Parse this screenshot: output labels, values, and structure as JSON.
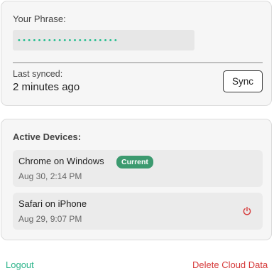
{
  "phrase_section": {
    "label": "Your Phrase:",
    "masked_phrase": "••••••••••••••••••••",
    "last_synced_label": "Last synced:",
    "last_synced_value": "2 minutes ago",
    "sync_button_label": "Sync"
  },
  "devices_section": {
    "title": "Active Devices:",
    "devices": [
      {
        "name": "Chrome on Windows",
        "time": "Aug 30, 2:14 PM",
        "badge": "Current",
        "is_current": true
      },
      {
        "name": "Safari on iPhone",
        "time": "Aug 29, 9:07 PM",
        "action_icon": "power-icon",
        "is_current": false
      }
    ]
  },
  "footer": {
    "logout_label": "Logout",
    "delete_label": "Delete Cloud Data"
  },
  "colors": {
    "accent": "#2bb48a",
    "badge": "#3c9a6f",
    "danger": "#d63b3b"
  }
}
